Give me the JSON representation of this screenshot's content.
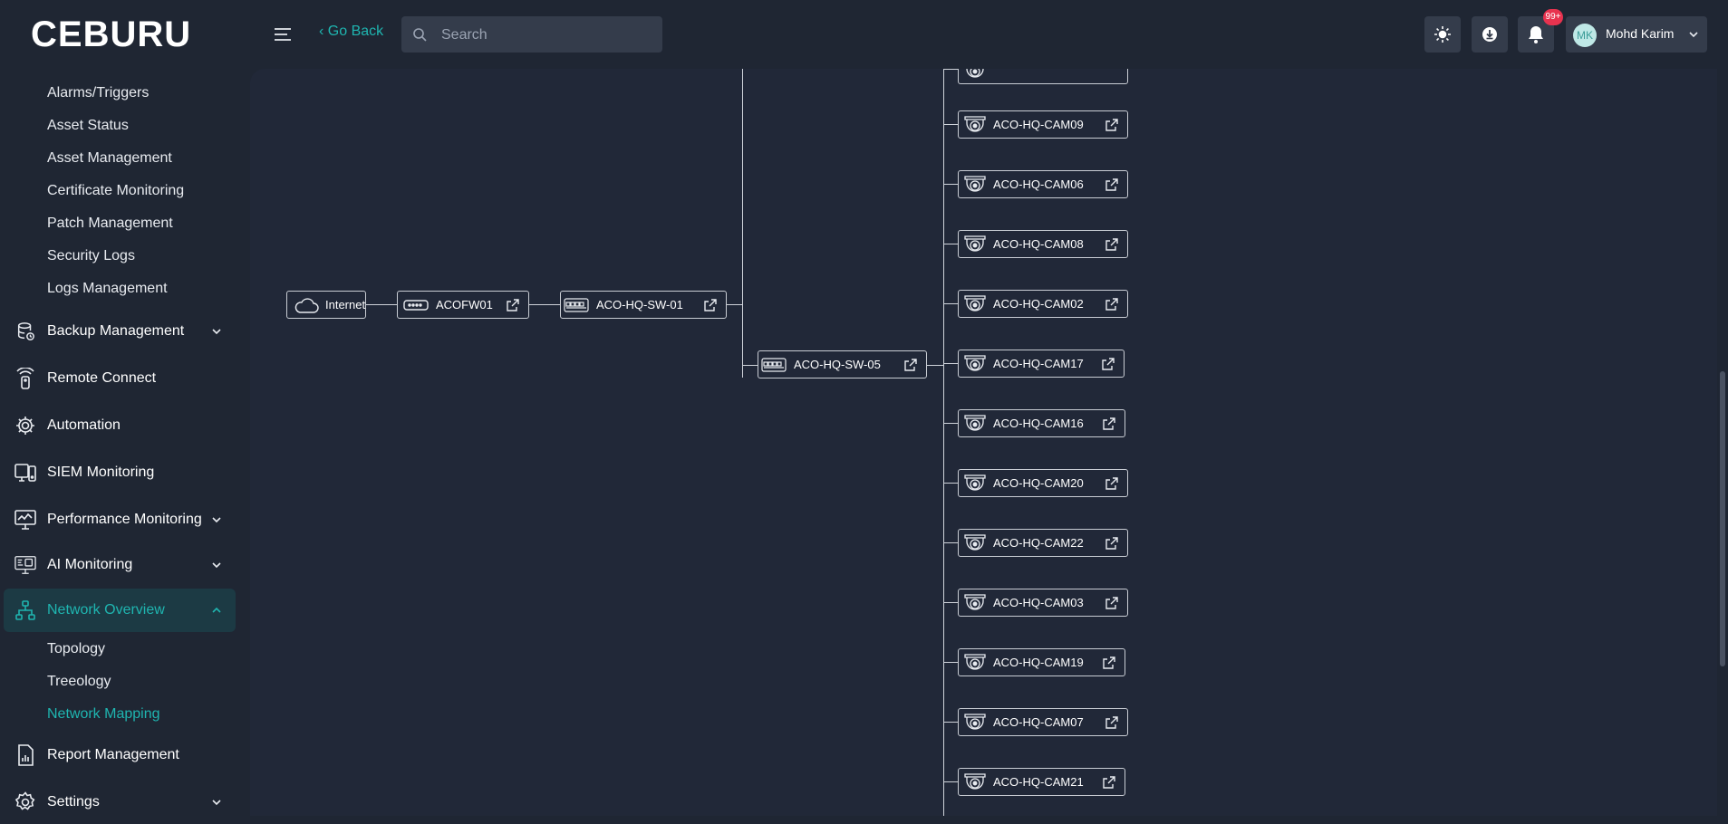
{
  "app": {
    "logo_text": "CEBURU"
  },
  "header": {
    "go_back": "‹ Go Back",
    "search_placeholder": "Search",
    "notification_count": "99+",
    "user": {
      "initials": "MK",
      "name": "Mohd Karim"
    }
  },
  "sidebar": {
    "top_sub_items": [
      "Alarms/Triggers",
      "Asset Status",
      "Asset Management",
      "Certificate Monitoring",
      "Patch Management",
      "Security Logs",
      "Logs Management"
    ],
    "items": [
      {
        "label": "Backup Management",
        "icon": "database-icon",
        "chevron": true
      },
      {
        "label": "Remote Connect",
        "icon": "remote-icon",
        "chevron": false
      },
      {
        "label": "Automation",
        "icon": "gear-automation-icon",
        "chevron": false
      },
      {
        "label": "SIEM Monitoring",
        "icon": "siem-icon",
        "chevron": false
      },
      {
        "label": "Performance Monitoring",
        "icon": "monitor-chart-icon",
        "chevron": true
      },
      {
        "label": "AI Monitoring",
        "icon": "ai-monitor-icon",
        "chevron": true
      },
      {
        "label": "Network Overview",
        "icon": "network-icon",
        "chevron": true,
        "active": true
      }
    ],
    "network_sub_items": [
      "Topology",
      "Treeology",
      "Network Mapping"
    ],
    "bottom_items": [
      {
        "label": "Report Management",
        "icon": "report-icon"
      },
      {
        "label": "Settings",
        "icon": "settings-icon"
      }
    ]
  },
  "topology": {
    "internet": "Internet",
    "firewall": "ACOFW01",
    "core_switch": "ACO-HQ-SW-01",
    "access_switch": "ACO-HQ-SW-05",
    "cameras": [
      "ACO-HQ-CAM09",
      "ACO-HQ-CAM06",
      "ACO-HQ-CAM08",
      "ACO-HQ-CAM02",
      "ACO-HQ-CAM17",
      "ACO-HQ-CAM16",
      "ACO-HQ-CAM20",
      "ACO-HQ-CAM22",
      "ACO-HQ-CAM03",
      "ACO-HQ-CAM19",
      "ACO-HQ-CAM07",
      "ACO-HQ-CAM21"
    ]
  },
  "colors": {
    "accent": "#1fb5b0",
    "background": "#1f2633",
    "badge": "#e8334f"
  }
}
